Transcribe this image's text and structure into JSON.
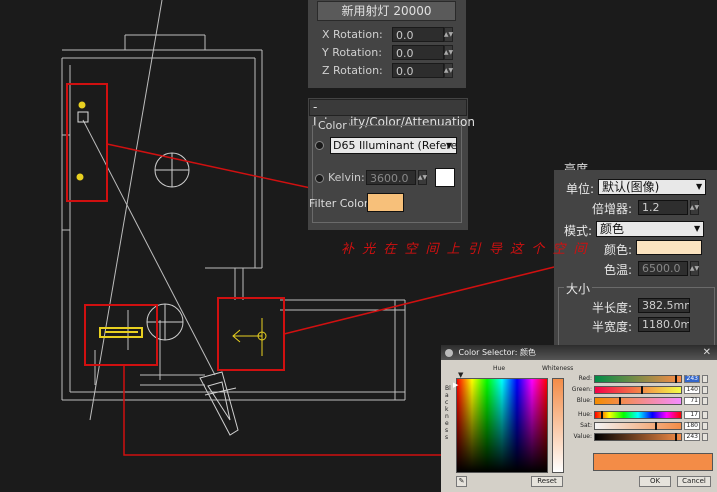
{
  "light_panel": {
    "light_name": "新用射灯 20000",
    "rotations": [
      {
        "label": "X Rotation:",
        "value": "0.0"
      },
      {
        "label": "Y Rotation:",
        "value": "0.0"
      },
      {
        "label": "Z Rotation:",
        "value": "0.0"
      }
    ]
  },
  "intensity_rollout": {
    "title": "- Intensity/Color/Attenuation",
    "group_label": "Color",
    "preset_value": "D65 Illuminant (Refere",
    "kelvin_label": "Kelvin:",
    "kelvin_value": "3600.0",
    "filter_color_label": "Filter Color:",
    "filter_color": "#f7c07a"
  },
  "chinese_panel": {
    "header_partial": "亮度",
    "unit_label": "单位:",
    "unit_value": "默认(图像)",
    "multiplier_label": "倍增器:",
    "multiplier_value": "1.2",
    "mode_label": "模式:",
    "mode_value": "颜色",
    "color_label": "颜色:",
    "color_swatch": "#fbe3c0",
    "temp_label": "色温:",
    "temp_value": "6500.0",
    "size_header": "大小",
    "half_length_label": "半长度:",
    "half_length_value": "382.5mm",
    "half_width_label": "半宽度:",
    "half_width_value": "1180.0mn"
  },
  "annotation_text": "补 光 在 空 间 上 引 导 这 个 空 间",
  "color_selector": {
    "title": "Color Selector: 颜色",
    "hue_label": "Hue",
    "whiteness_label": "Whiteness",
    "blackness_label": "Blackness",
    "channels": [
      {
        "label": "Red:",
        "value": "243",
        "fraction": 0.95,
        "selected": true
      },
      {
        "label": "Green:",
        "value": "140",
        "fraction": 0.55,
        "selected": false
      },
      {
        "label": "Blue:",
        "value": "71",
        "fraction": 0.28,
        "selected": false
      },
      {
        "label": "Hue:",
        "value": "17",
        "fraction": 0.07,
        "selected": false
      },
      {
        "label": "Sat:",
        "value": "180",
        "fraction": 0.71,
        "selected": false
      },
      {
        "label": "Value:",
        "value": "243",
        "fraction": 0.95,
        "selected": false
      }
    ],
    "result_color": "#f38c47",
    "reset_label": "Reset",
    "ok_label": "OK",
    "cancel_label": "Cancel"
  },
  "colors": {
    "annotation_red": "#d01010",
    "light_gizmo": "#e8d020"
  }
}
